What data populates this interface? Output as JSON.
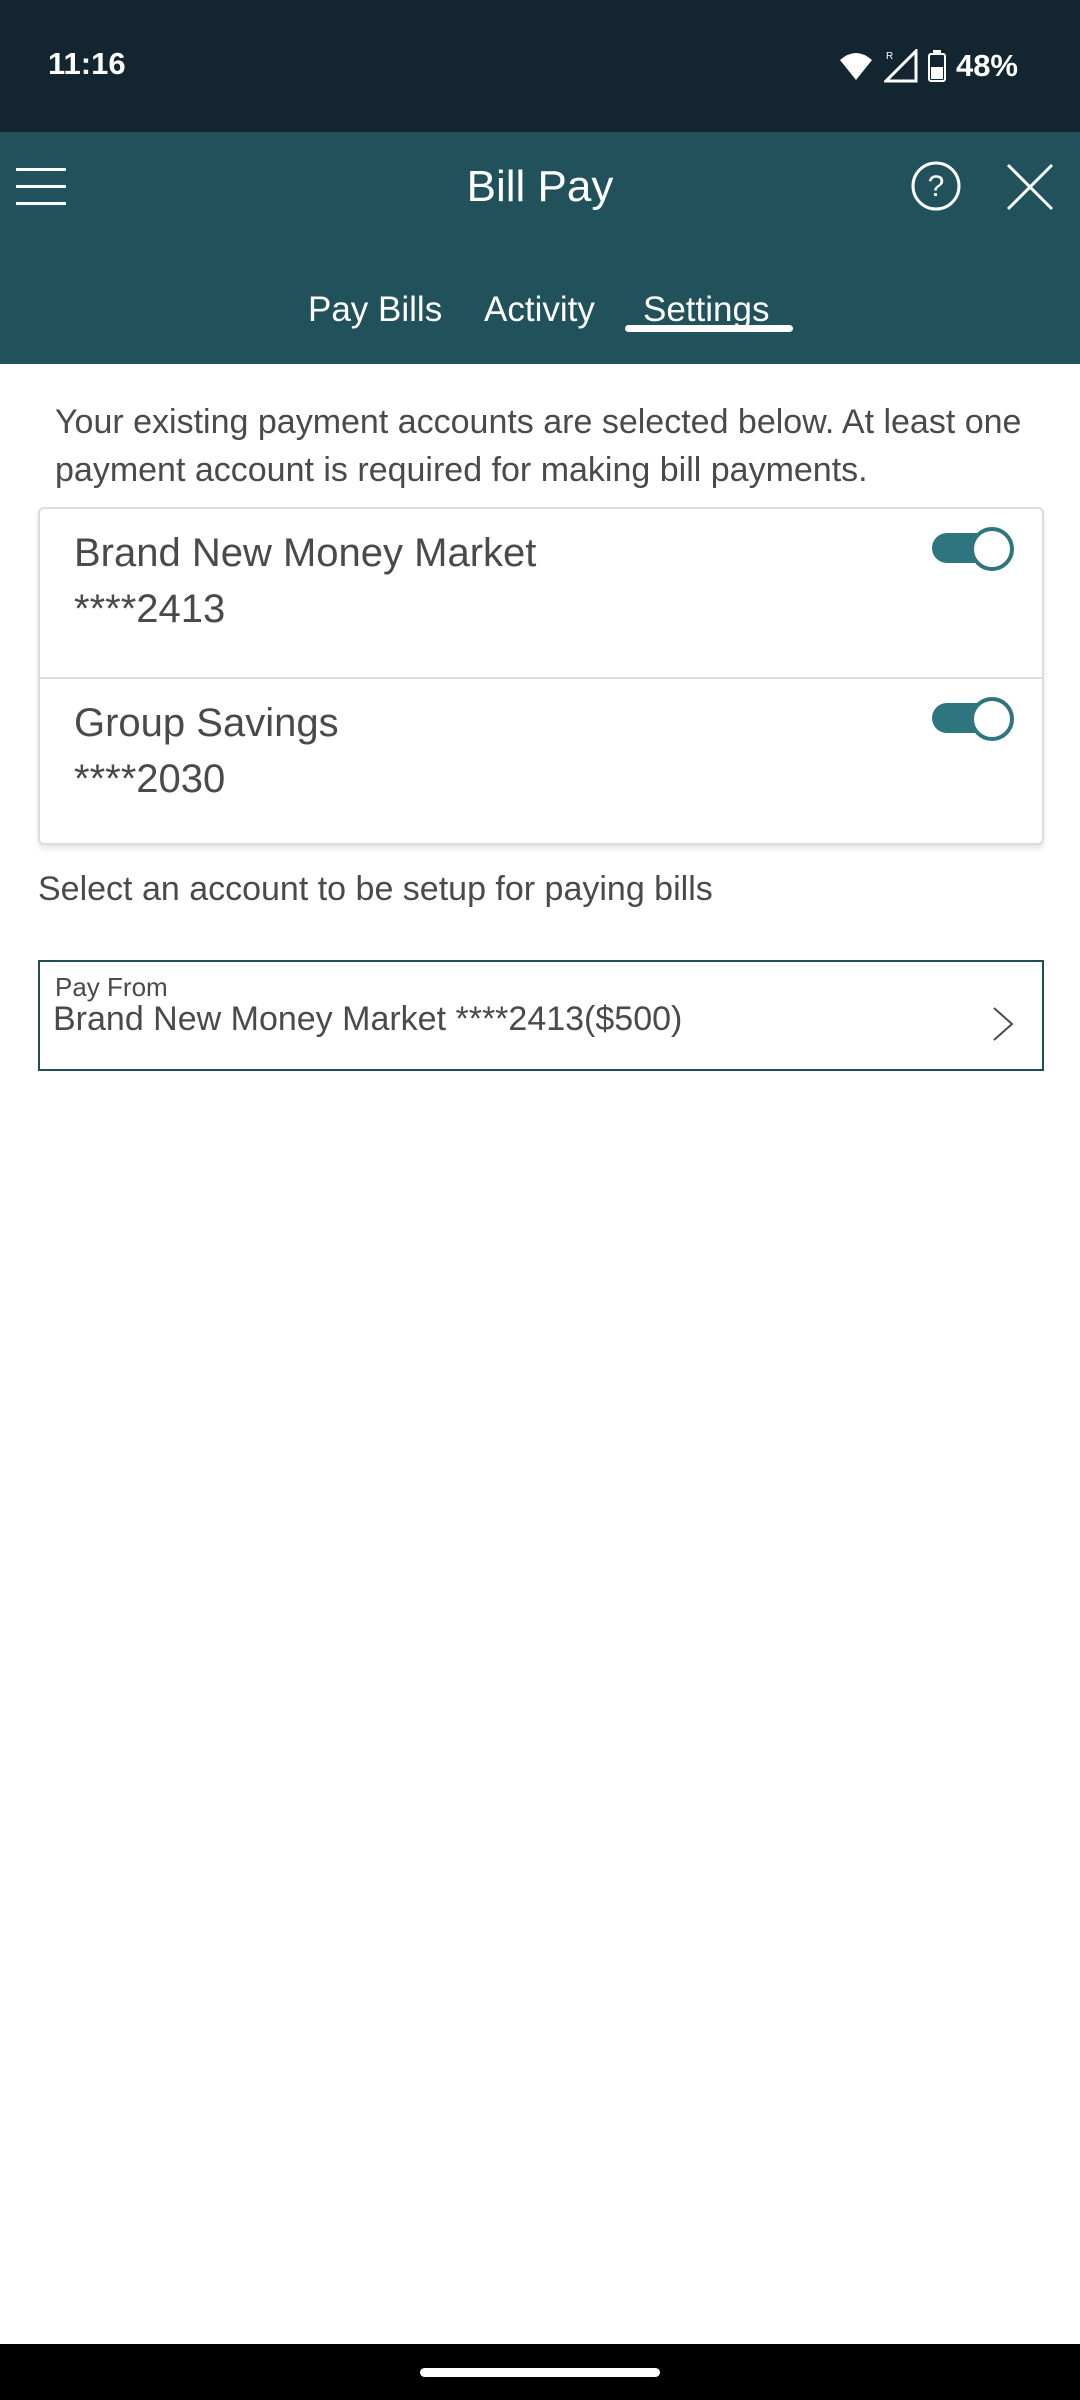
{
  "status_bar": {
    "time": "11:16",
    "battery": "48%",
    "icons": [
      "wifi-icon",
      "signal-icon",
      "battery-icon"
    ]
  },
  "header": {
    "title": "Bill Pay",
    "icons": [
      "menu-icon",
      "help-icon",
      "close-icon"
    ],
    "background": "#21515b"
  },
  "tabs": [
    {
      "label": "Pay Bills",
      "active": false
    },
    {
      "label": "Activity",
      "active": false
    },
    {
      "label": "Settings",
      "active": true
    }
  ],
  "intro_text": "Your existing payment accounts are selected below. At least one payment account is required for making bill payments.",
  "accounts": [
    {
      "name": "Brand New Money Market",
      "number": "****2413",
      "enabled": true
    },
    {
      "name": "Group Savings",
      "number": "****2030",
      "enabled": true
    }
  ],
  "select_label": "Select an account to be setup for paying bills",
  "pay_from": {
    "label": "Pay From",
    "value": "Brand New Money Market ****2413($500)"
  },
  "colors": {
    "status_bar": "#122530",
    "accent": "#2f7580",
    "text": "#4a4a4a"
  }
}
